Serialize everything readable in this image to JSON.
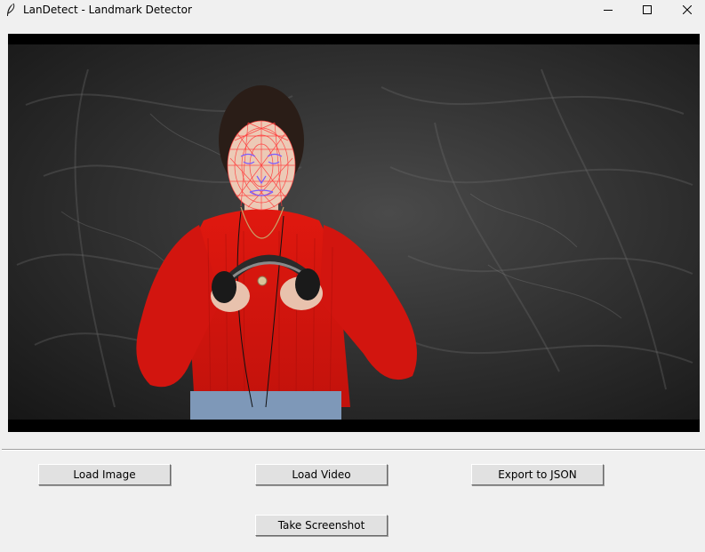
{
  "window": {
    "title": "LanDetect - Landmark Detector",
    "icon": "feather-icon",
    "controls": [
      "minimize-icon",
      "maximize-icon",
      "close-icon"
    ]
  },
  "preview": {
    "content": "video frame with face mesh landmark overlay",
    "mesh_color": "#ff3b3b",
    "landmark_color": "#7a5cff"
  },
  "buttons": {
    "load_image": "Load Image",
    "load_video": "Load Video",
    "export_json": "Export to JSON",
    "take_screenshot": "Take Screenshot"
  },
  "colors": {
    "window_bg": "#f0f0f0",
    "button_face": "#e1e1e1",
    "sweater": "#d8140f"
  }
}
